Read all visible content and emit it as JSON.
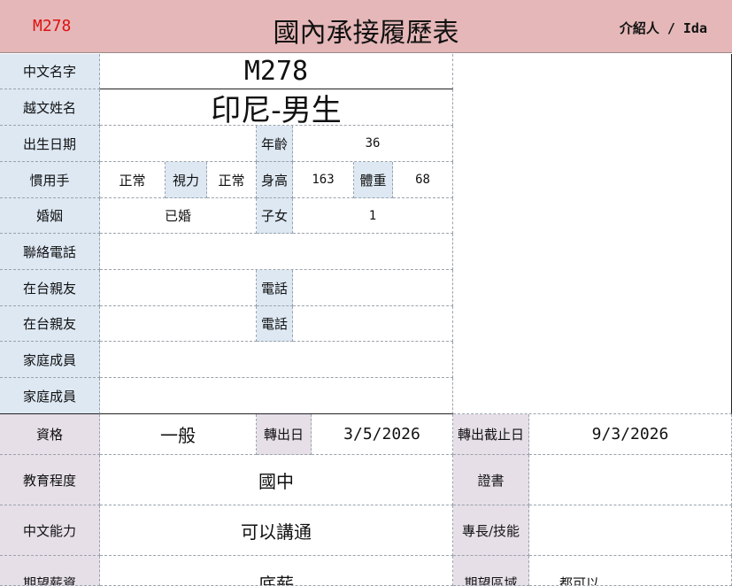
{
  "header": {
    "code": "M278",
    "title": "國內承接履歷表",
    "introducer": "介紹人 / Ida"
  },
  "labels": {
    "chinese_name": "中文名字",
    "viet_name": "越文姓名",
    "birth": "出生日期",
    "age": "年齡",
    "hand": "慣用手",
    "vision": "視力",
    "height": "身高",
    "weight": "體重",
    "marriage": "婚姻",
    "children": "子女",
    "contact_phone": "聯絡電話",
    "relative": "在台親友",
    "phone": "電話",
    "family": "家庭成員",
    "qualification": "資格",
    "transfer_date": "轉出日",
    "transfer_deadline": "轉出截止日",
    "education": "教育程度",
    "certificate": "證書",
    "chinese_ability": "中文能力",
    "skills": "專長/技能",
    "expected_salary": "期望薪資",
    "expected_area": "期望區域"
  },
  "values": {
    "chinese_name": "M278",
    "viet_name": "印尼-男生",
    "birth": "",
    "age": "36",
    "hand": "正常",
    "vision": "正常",
    "height": "163",
    "weight": "68",
    "marriage": "已婚",
    "children": "1",
    "contact_phone": "",
    "relative1": "",
    "relative1_phone": "",
    "relative2": "",
    "relative2_phone": "",
    "family1": "",
    "family2": "",
    "qualification": "一般",
    "transfer_date": "3/5/2026",
    "transfer_deadline": "9/3/2026",
    "education": "國中",
    "certificate": "",
    "chinese_ability": "可以講通",
    "skills": "",
    "expected_salary": "底薪",
    "expected_area": "都可以"
  }
}
